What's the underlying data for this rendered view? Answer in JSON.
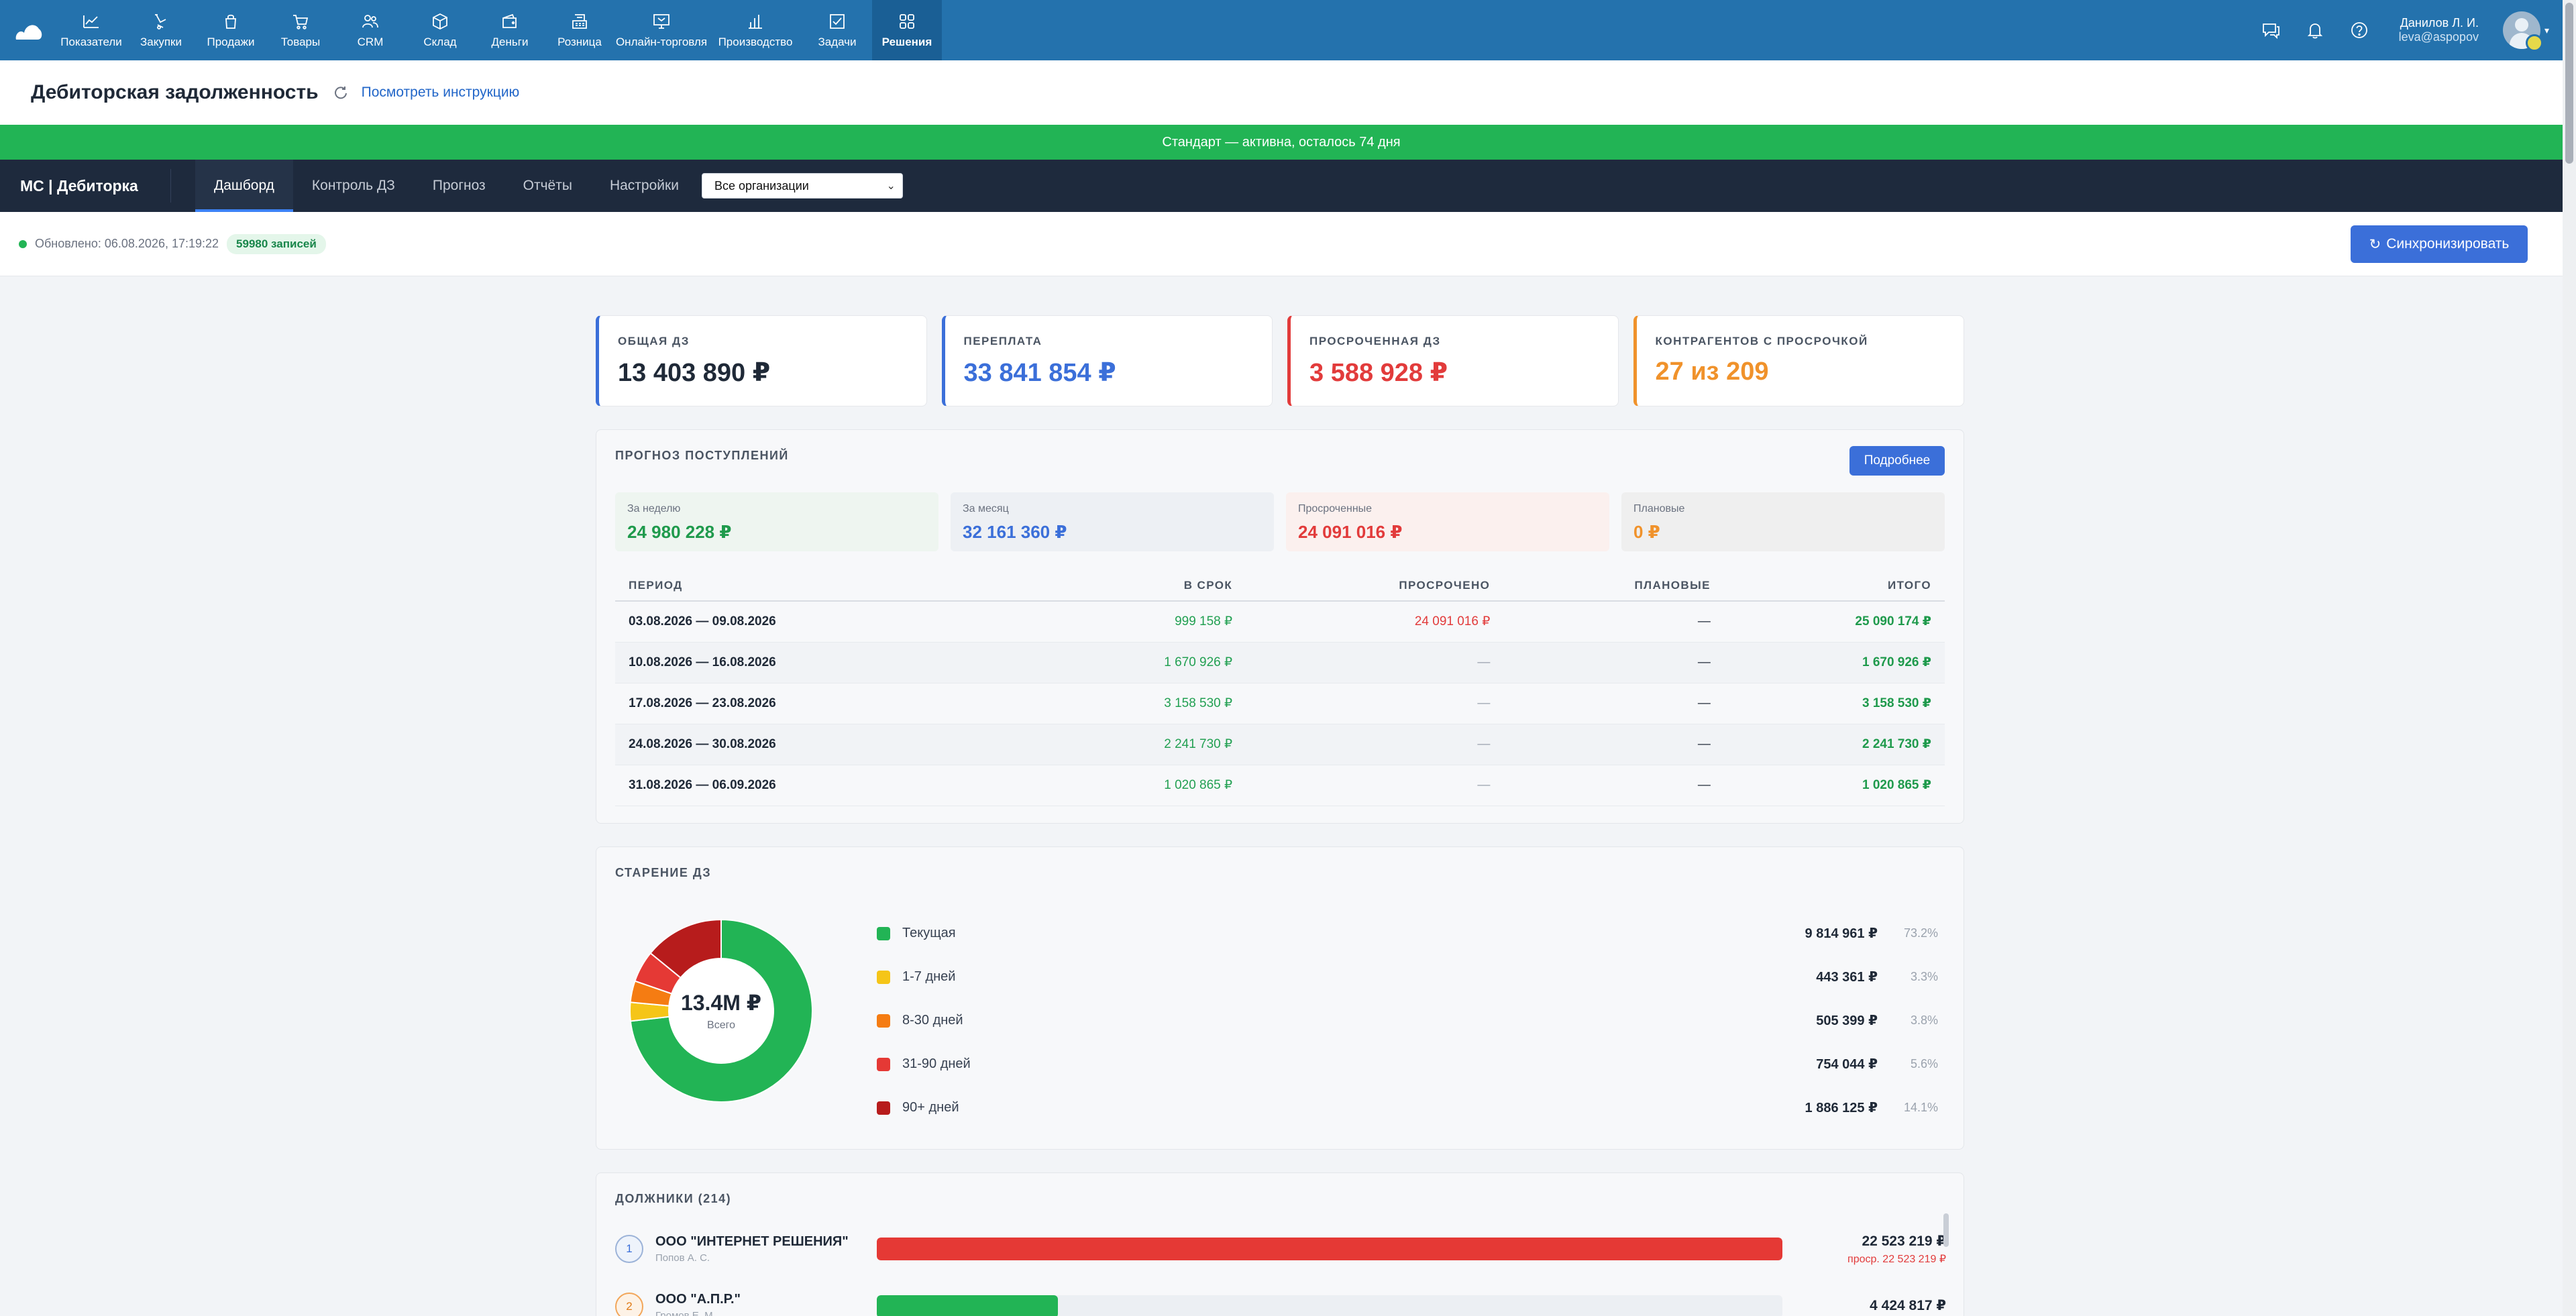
{
  "topnav": {
    "items": [
      {
        "label": "Показатели",
        "icon": "chart-line-icon"
      },
      {
        "label": "Закупки",
        "icon": "purchase-icon"
      },
      {
        "label": "Продажи",
        "icon": "bag-icon"
      },
      {
        "label": "Товары",
        "icon": "cart-icon"
      },
      {
        "label": "CRM",
        "icon": "people-icon"
      },
      {
        "label": "Склад",
        "icon": "box-icon"
      },
      {
        "label": "Деньги",
        "icon": "wallet-icon"
      },
      {
        "label": "Розница",
        "icon": "cash-register-icon"
      },
      {
        "label": "Онлайн-торговля",
        "icon": "online-store-icon"
      },
      {
        "label": "Производство",
        "icon": "bar-chart-icon"
      },
      {
        "label": "Задачи",
        "icon": "task-check-icon"
      },
      {
        "label": "Решения",
        "icon": "apps-grid-icon"
      }
    ],
    "active": "Решения",
    "user_name": "Данилов Л. И.",
    "user_email": "leva@aspopov"
  },
  "page": {
    "title": "Дебиторская задолженность",
    "guide_link": "Посмотреть инструкцию",
    "banner": "Стандарт — активна, осталось 74 дня"
  },
  "subnav": {
    "brand": "МС | Дебиторка",
    "tabs": [
      "Дашборд",
      "Контроль ДЗ",
      "Прогноз",
      "Отчёты",
      "Настройки"
    ],
    "active_tab": "Дашборд",
    "org_select": "Все организации"
  },
  "status": {
    "updated": "Обновлено: 06.08.2026, 17:19:22",
    "records": "59980 записей",
    "sync_button": "Синхронизировать"
  },
  "kpis": [
    {
      "label": "ОБЩАЯ ДЗ",
      "value": "13 403 890 ₽",
      "color": "#1f2937",
      "border": "#3b6fd9"
    },
    {
      "label": "ПЕРЕПЛАТА",
      "value": "33 841 854 ₽",
      "color": "#3b6fd9",
      "border": "#3b6fd9"
    },
    {
      "label": "ПРОСРОЧЕННАЯ ДЗ",
      "value": "3 588 928 ₽",
      "color": "#e23b3b",
      "border": "#e23b3b"
    },
    {
      "label": "КОНТРАГЕНТОВ С ПРОСРОЧКОЙ",
      "value": "27 из 209",
      "color": "#f0922b",
      "border": "#f0922b"
    }
  ],
  "forecast": {
    "title": "ПРОГНОЗ ПОСТУПЛЕНИЙ",
    "more_button": "Подробнее",
    "boxes": [
      {
        "label": "За неделю",
        "value": "24 980 228 ₽",
        "color": "#1f9a4c",
        "bg": "#eef5f0"
      },
      {
        "label": "За месяц",
        "value": "32 161 360 ₽",
        "color": "#3b6fd9",
        "bg": "#edf0f4"
      },
      {
        "label": "Просроченные",
        "value": "24 091 016 ₽",
        "color": "#e23b3b",
        "bg": "#fbf0ee"
      },
      {
        "label": "Плановые",
        "value": "0 ₽",
        "color": "#f0922b",
        "bg": "#efefef"
      }
    ],
    "columns": [
      "ПЕРИОД",
      "В СРОК",
      "ПРОСРОЧЕНО",
      "ПЛАНОВЫЕ",
      "ИТОГО"
    ],
    "rows": [
      {
        "period": "03.08.2026 — 09.08.2026",
        "ontime": "999 158 ₽",
        "overdue": "24 091 016 ₽",
        "planned": "—",
        "total": "25 090 174 ₽"
      },
      {
        "period": "10.08.2026 — 16.08.2026",
        "ontime": "1 670 926 ₽",
        "overdue": "—",
        "planned": "—",
        "total": "1 670 926 ₽"
      },
      {
        "period": "17.08.2026 — 23.08.2026",
        "ontime": "3 158 530 ₽",
        "overdue": "—",
        "planned": "—",
        "total": "3 158 530 ₽"
      },
      {
        "period": "24.08.2026 — 30.08.2026",
        "ontime": "2 241 730 ₽",
        "overdue": "—",
        "planned": "—",
        "total": "2 241 730 ₽"
      },
      {
        "period": "31.08.2026 — 06.09.2026",
        "ontime": "1 020 865 ₽",
        "overdue": "—",
        "planned": "—",
        "total": "1 020 865 ₽"
      }
    ]
  },
  "aging": {
    "title": "СТАРЕНИЕ ДЗ",
    "center_value": "13.4M ₽",
    "center_label": "Всего",
    "buckets": [
      {
        "name": "Текущая",
        "amount": "9 814 961 ₽",
        "pct": "73.2%",
        "share": 73.2,
        "color": "#22b455"
      },
      {
        "name": "1-7 дней",
        "amount": "443 361 ₽",
        "pct": "3.3%",
        "share": 3.3,
        "color": "#f5c518"
      },
      {
        "name": "8-30 дней",
        "amount": "505 399 ₽",
        "pct": "3.8%",
        "share": 3.8,
        "color": "#f57c12"
      },
      {
        "name": "31-90 дней",
        "amount": "754 044 ₽",
        "pct": "5.6%",
        "share": 5.6,
        "color": "#e53935"
      },
      {
        "name": "90+ дней",
        "amount": "1 886 125 ₽",
        "pct": "14.1%",
        "share": 14.1,
        "color": "#b71c1c"
      }
    ]
  },
  "debtors": {
    "title": "ДОЛЖНИКИ (214)",
    "items": [
      {
        "rank": "1",
        "name": "ООО \"ИНТЕРНЕТ РЕШЕНИЯ\"",
        "manager": "Попов А. С.",
        "amount": "22 523 219 ₽",
        "overdue": "проср. 22 523 219 ₽",
        "share": 1.0,
        "color": "#e53935"
      },
      {
        "rank": "2",
        "name": "ООО \"А.П.Р.\"",
        "manager": "Громов Е. М.",
        "amount": "4 424 817 ₽",
        "overdue": "",
        "share": 0.2,
        "color": "#22b455"
      }
    ]
  }
}
